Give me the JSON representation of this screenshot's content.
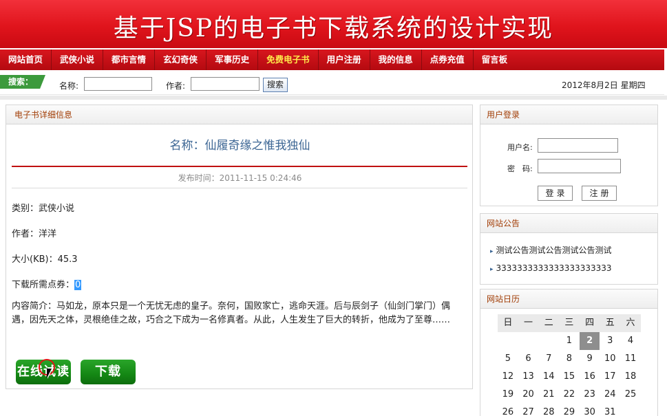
{
  "banner": {
    "title": "基于JSP的电子书下载系统的设计实现"
  },
  "nav": {
    "items": [
      {
        "label": "网站首页",
        "active": false
      },
      {
        "label": "武侠小说",
        "active": false
      },
      {
        "label": "都市言情",
        "active": false
      },
      {
        "label": "玄幻奇侠",
        "active": false
      },
      {
        "label": "军事历史",
        "active": false
      },
      {
        "label": "免费电子书",
        "active": true
      },
      {
        "label": "用户注册",
        "active": false
      },
      {
        "label": "我的信息",
        "active": false
      },
      {
        "label": "点券充值",
        "active": false
      },
      {
        "label": "留言板",
        "active": false
      }
    ]
  },
  "search": {
    "tag": "搜索：",
    "name_label": "名称:",
    "name_value": "",
    "author_label": "作者:",
    "author_value": "",
    "button": "搜索"
  },
  "date": "2012年8月2日 星期四",
  "detail": {
    "panel_title": "电子书详细信息",
    "book_title": "名称：仙履奇缘之惟我独仙",
    "publish_time": "发布时间：2011-11-15 0:24:46",
    "category": "类别：武侠小说",
    "author": "作者：洋洋",
    "size": "大小(KB)：45.3",
    "points_label": "下载所需点券：",
    "points_value": "0",
    "summary": "内容简介：马如龙，原本只是一个无忧无虑的皇子。奈何，国败家亡，逃命天涯。后与辰剑子（仙剑门掌门）偶遇，因先天之体，灵根绝佳之故，巧合之下成为一名修真者。从此，人生发生了巨大的转折，他成为了至尊……",
    "read_button": "在线试读",
    "download_button": "下载"
  },
  "login": {
    "panel_title": "用户登录",
    "username_label": "用户名:",
    "username_value": "",
    "password_label": "密　码:",
    "password_value": "",
    "login_button": "登录",
    "register_button": "注册"
  },
  "notice": {
    "panel_title": "网站公告",
    "items": [
      "测试公告测试公告测试公告测试",
      "3333333333333333333333"
    ]
  },
  "calendar": {
    "panel_title": "网站日历",
    "weekdays": [
      "日",
      "一",
      "二",
      "三",
      "四",
      "五",
      "六"
    ],
    "today": 2,
    "weeks": [
      [
        "",
        "",
        "",
        1,
        2,
        3,
        4
      ],
      [
        5,
        6,
        7,
        8,
        9,
        10,
        11
      ],
      [
        12,
        13,
        14,
        15,
        16,
        17,
        18
      ],
      [
        19,
        20,
        21,
        22,
        23,
        24,
        25
      ],
      [
        26,
        27,
        28,
        29,
        30,
        31,
        ""
      ]
    ]
  },
  "colors": {
    "banner_red": "#e0141c",
    "nav_red": "#c40c12",
    "nav_active_text": "#ffe94a",
    "panel_title_text": "#a13d06",
    "book_title_text": "#3c6694",
    "button_green": "#148714"
  }
}
